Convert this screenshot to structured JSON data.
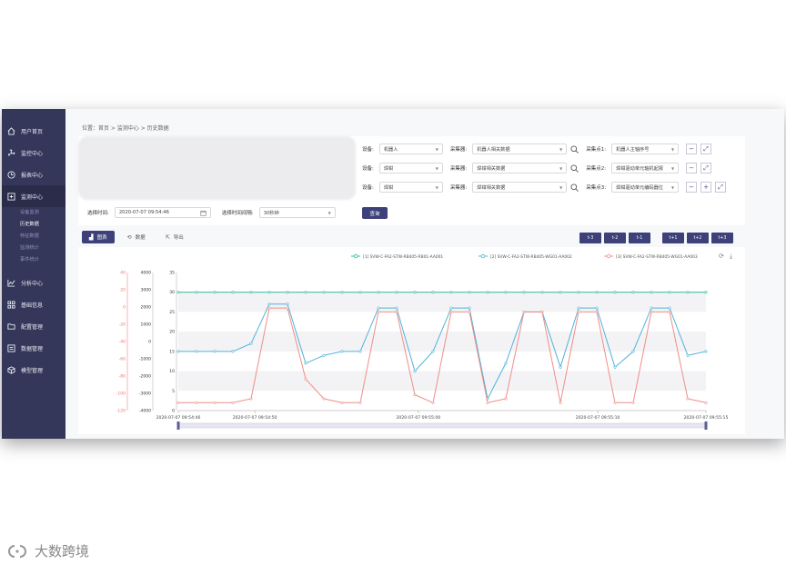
{
  "sidebar": {
    "items": [
      {
        "label": "用户首页",
        "icon": "home-icon"
      },
      {
        "label": "监控中心",
        "icon": "fan-icon"
      },
      {
        "label": "报表中心",
        "icon": "clock-icon"
      },
      {
        "label": "监测中心",
        "icon": "monitor-icon",
        "active": true,
        "children": [
          {
            "label": "设备监测"
          },
          {
            "label": "历史数据",
            "active": true
          },
          {
            "label": "特征数据"
          },
          {
            "label": "监测统计"
          },
          {
            "label": "事件统计"
          }
        ]
      },
      {
        "label": "分析中心",
        "icon": "line-chart-icon"
      },
      {
        "label": "基础信息",
        "icon": "grid-icon"
      },
      {
        "label": "配置管理",
        "icon": "folder-icon"
      },
      {
        "label": "数据管理",
        "icon": "database-icon"
      },
      {
        "label": "模型管理",
        "icon": "cube-icon"
      }
    ]
  },
  "breadcrumb": "位置：首页 > 监测中心 > 历史数据",
  "filters": {
    "rows": [
      {
        "device_label": "设备:",
        "device_value": "机器人",
        "collector_label": "采集器:",
        "collector_value": "机器人相关数据",
        "point_label": "采集点1:",
        "point_value": "机器人主轴序号"
      },
      {
        "device_label": "设备:",
        "device_value": "焊钳",
        "collector_label": "采集器:",
        "collector_value": "焊钳相关数据",
        "point_label": "采集点2:",
        "point_value": "焊钳驱动单元轴机起报"
      },
      {
        "device_label": "设备:",
        "device_value": "焊钳",
        "collector_label": "采集器:",
        "collector_value": "焊钳相关数据",
        "point_label": "采集点3:",
        "point_value": "焊钳驱动单元编码器位"
      }
    ],
    "start_label": "选择时间:",
    "start_value": "2020-07-07 09:54:46",
    "duration_label": "选择时间间隔:",
    "duration_value": "30秒钟",
    "query_label": "查询"
  },
  "tabs": [
    {
      "label": "图表",
      "icon": "chart-icon",
      "active": true
    },
    {
      "label": "数据",
      "icon": "refresh-icon"
    },
    {
      "label": "导出",
      "icon": "export-icon"
    }
  ],
  "range_buttons_left": [
    "t-3",
    "t-2",
    "t-1"
  ],
  "range_buttons_right": [
    "t+1",
    "t+2",
    "t+3"
  ],
  "chart_data": {
    "type": "line",
    "legend": [
      "[1] SVW-C-FA2-STW-RB405-RB01-AA001",
      "[2] SVW-C-FA2-STW-RB405-WG01-AA002",
      "[3] SVW-C-FA2-STW-RB405-WG01-AA003"
    ],
    "legend_position": "top-right",
    "y_axes": [
      {
        "ticks": [
          "40",
          "20",
          "0",
          "-20",
          "-40",
          "-60",
          "-80",
          "-100",
          "-120"
        ],
        "color": "#e8766f"
      },
      {
        "ticks": [
          "4000",
          "3000",
          "2000",
          "1000",
          "0",
          "-1000",
          "-2000",
          "-3000",
          "-4000"
        ],
        "color": "#333333"
      },
      {
        "ticks": [
          "35",
          "30",
          "25",
          "20",
          "15",
          "10",
          "5",
          "0"
        ],
        "color": "#333333"
      }
    ],
    "x_ticks": [
      "2020-07-07 09:54:46",
      "2020-07-07 09:54:50",
      "2020-07-07 09:55:00",
      "2020-07-07 09:55:10",
      "2020-07-07 09:55:15"
    ],
    "x_tick_fractions": [
      0,
      0.145,
      0.455,
      0.795,
      1
    ],
    "series": [
      {
        "color": "#2bb8a0",
        "values": [
          30,
          30,
          30,
          30,
          30,
          30,
          30,
          30,
          30,
          30,
          30,
          30,
          30,
          30,
          30,
          30,
          30,
          30,
          30,
          30,
          30,
          30,
          30,
          30,
          30,
          30,
          30,
          30,
          30,
          30
        ]
      },
      {
        "color": "#4fb3d9",
        "values": [
          15,
          15,
          15,
          15,
          17,
          27,
          27,
          12,
          14,
          15,
          15,
          26,
          26,
          10,
          15,
          26,
          26,
          3,
          12,
          25,
          25,
          11,
          26,
          26,
          11,
          15,
          26,
          26,
          14,
          15
        ]
      },
      {
        "color": "#f08d86",
        "values": [
          2,
          2,
          2,
          2,
          3,
          26,
          26,
          8,
          3,
          2,
          2,
          25,
          25,
          4,
          2,
          25,
          25,
          2,
          3,
          25,
          25,
          2,
          25,
          25,
          2,
          2,
          25,
          25,
          3,
          2
        ]
      }
    ],
    "x_range_note": "",
    "ylim_right": [
      0,
      35
    ],
    "grid": true
  },
  "watermark": "大数跨境"
}
